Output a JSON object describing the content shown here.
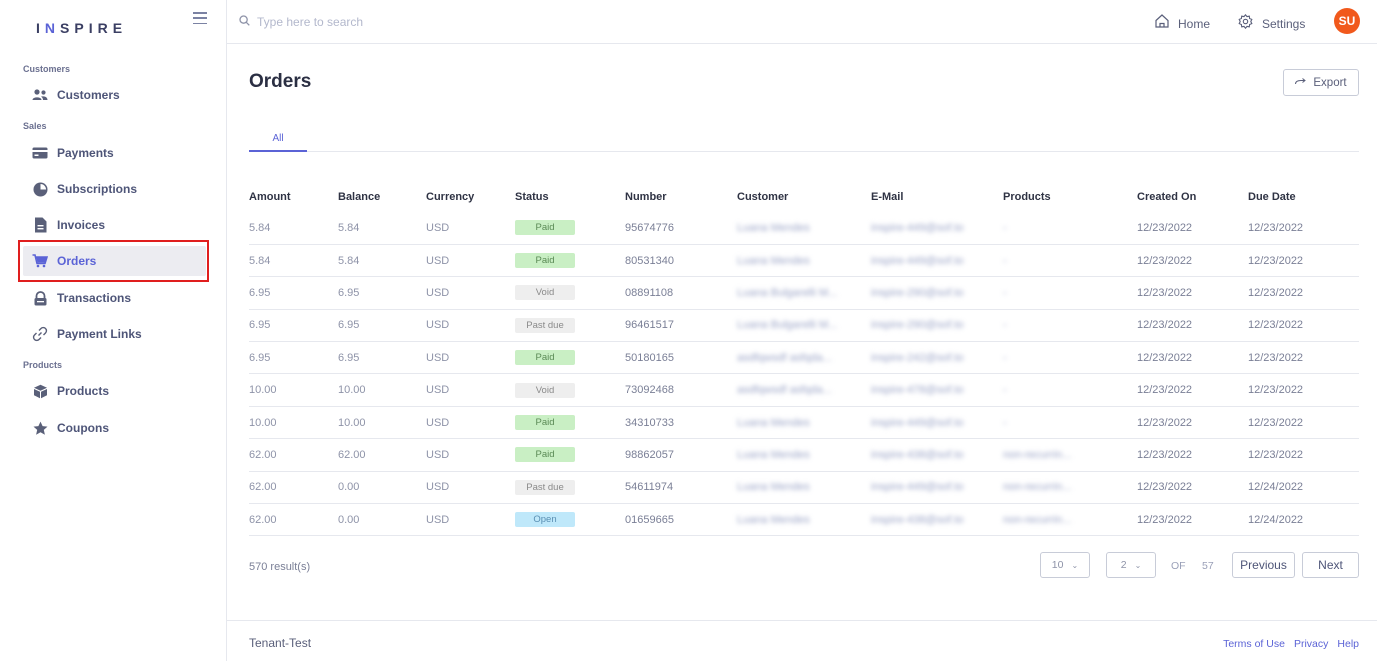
{
  "app": {
    "brand_pre": "I",
    "brand_accent": "N",
    "brand_post": "SPIRE"
  },
  "sidebar": {
    "sections": [
      {
        "label": "Customers"
      },
      {
        "label": "Sales"
      },
      {
        "label": "Products"
      }
    ],
    "items": [
      {
        "label": "Customers",
        "icon": "users-icon"
      },
      {
        "label": "Payments",
        "icon": "credit-card-icon"
      },
      {
        "label": "Subscriptions",
        "icon": "pie-chart-icon"
      },
      {
        "label": "Invoices",
        "icon": "document-icon"
      },
      {
        "label": "Orders",
        "icon": "cart-icon",
        "active": true
      },
      {
        "label": "Transactions",
        "icon": "lock-icon"
      },
      {
        "label": "Payment Links",
        "icon": "link-icon"
      },
      {
        "label": "Products",
        "icon": "box-icon"
      },
      {
        "label": "Coupons",
        "icon": "star-icon"
      }
    ]
  },
  "topbar": {
    "search_placeholder": "Type here to search",
    "home_label": "Home",
    "settings_label": "Settings",
    "avatar_initials": "SU"
  },
  "main": {
    "title": "Orders",
    "export_label": "Export",
    "tabs": [
      {
        "label": "All"
      }
    ]
  },
  "table": {
    "columns": [
      "Amount",
      "Balance",
      "Currency",
      "Status",
      "Number",
      "Customer",
      "E-Mail",
      "Products",
      "Created On",
      "Due Date"
    ],
    "rows": [
      {
        "amount": "5.84",
        "balance": "5.84",
        "currency": "USD",
        "status": "Paid",
        "number": "95674776",
        "customer": "Luana Mendes",
        "email": "inspire-449@sof.to",
        "products": "-",
        "created": "12/23/2022",
        "due": "12/23/2022"
      },
      {
        "amount": "5.84",
        "balance": "5.84",
        "currency": "USD",
        "status": "Paid",
        "number": "80531340",
        "customer": "Luana Mendes",
        "email": "inspire-449@sof.to",
        "products": "-",
        "created": "12/23/2022",
        "due": "12/23/2022"
      },
      {
        "amount": "6.95",
        "balance": "6.95",
        "currency": "USD",
        "status": "Void",
        "number": "08891108",
        "customer": "Luana Bulgarelli M...",
        "email": "inspire-290@sof.to",
        "products": "-",
        "created": "12/23/2022",
        "due": "12/23/2022"
      },
      {
        "amount": "6.95",
        "balance": "6.95",
        "currency": "USD",
        "status": "Past due",
        "number": "96461517",
        "customer": "Luana Bulgarelli M...",
        "email": "inspire-290@sof.to",
        "products": "-",
        "created": "12/23/2022",
        "due": "12/23/2022"
      },
      {
        "amount": "6.95",
        "balance": "6.95",
        "currency": "USD",
        "status": "Paid",
        "number": "50180165",
        "customer": "asdfqwsdf asfqda...",
        "email": "inspire-242@sof.to",
        "products": "-",
        "created": "12/23/2022",
        "due": "12/23/2022"
      },
      {
        "amount": "10.00",
        "balance": "10.00",
        "currency": "USD",
        "status": "Void",
        "number": "73092468",
        "customer": "asdfqwsdf asfqda...",
        "email": "inspire-478@sof.to",
        "products": "-",
        "created": "12/23/2022",
        "due": "12/23/2022"
      },
      {
        "amount": "10.00",
        "balance": "10.00",
        "currency": "USD",
        "status": "Paid",
        "number": "34310733",
        "customer": "Luana Mendes",
        "email": "inspire-449@sof.to",
        "products": "-",
        "created": "12/23/2022",
        "due": "12/23/2022"
      },
      {
        "amount": "62.00",
        "balance": "62.00",
        "currency": "USD",
        "status": "Paid",
        "number": "98862057",
        "customer": "Luana Mendes",
        "email": "inspire-438@sof.to",
        "products": "non-recurrin...",
        "created": "12/23/2022",
        "due": "12/23/2022"
      },
      {
        "amount": "62.00",
        "balance": "0.00",
        "currency": "USD",
        "status": "Past due",
        "number": "54611974",
        "customer": "Luana Mendes",
        "email": "inspire-449@sof.to",
        "products": "non-recurrin...",
        "created": "12/23/2022",
        "due": "12/24/2022"
      },
      {
        "amount": "62.00",
        "balance": "0.00",
        "currency": "USD",
        "status": "Open",
        "number": "01659665",
        "customer": "Luana Mendes",
        "email": "inspire-438@sof.to",
        "products": "non-recurrin...",
        "created": "12/23/2022",
        "due": "12/24/2022"
      }
    ]
  },
  "pagination": {
    "results_text": "570 result(s)",
    "page_size": "10",
    "current_page": "2",
    "of_label": "OF",
    "total_pages": "57",
    "previous_label": "Previous",
    "next_label": "Next"
  },
  "footer": {
    "tenant": "Tenant-Test",
    "links": [
      "Terms of Use",
      "Privacy",
      "Help"
    ]
  },
  "colors": {
    "accent": "#5b63d6",
    "avatar": "#f1591c",
    "highlight": "#e01e1e"
  }
}
